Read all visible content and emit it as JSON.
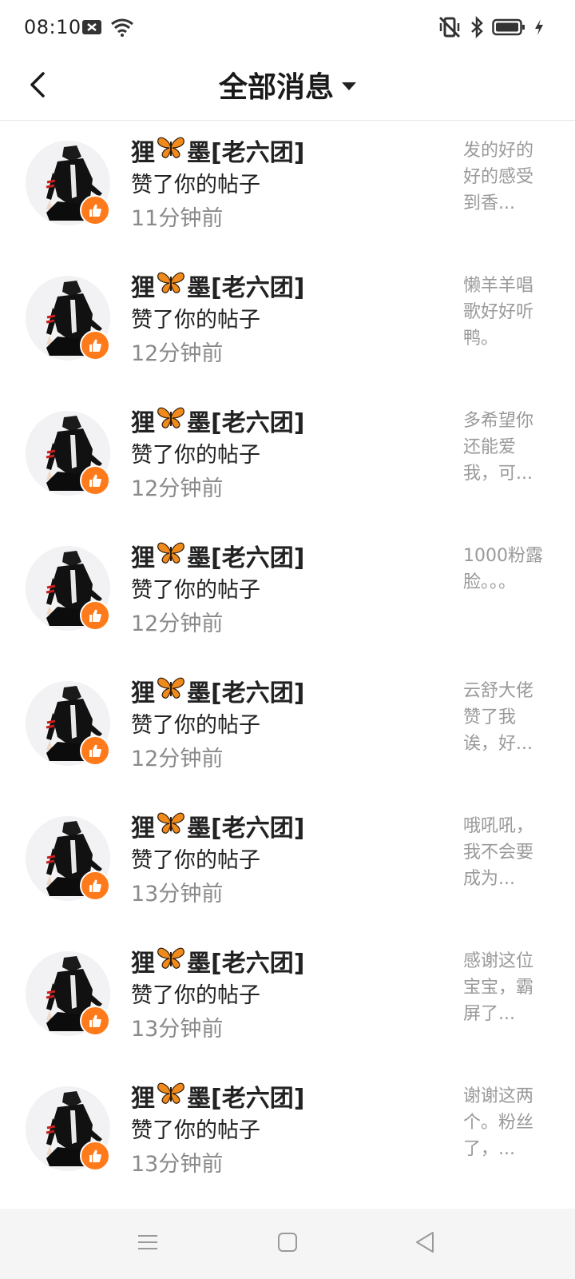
{
  "status_bar": {
    "time": "08:10",
    "icons_left": [
      "notification-x-icon",
      "wifi-icon"
    ],
    "icons_right": [
      "vibrate-icon",
      "bluetooth-icon",
      "battery-icon",
      "charging-icon"
    ]
  },
  "header": {
    "title": "全部消息",
    "back_icon": "back-arrow-icon",
    "dropdown_icon": "dropdown-arrow-icon"
  },
  "accent_color": "#ff7a1a",
  "messages": [
    {
      "name_part1": "狸",
      "name_part2": "墨[老六团]",
      "action": "赞了你的帖子",
      "time": "11分钟前",
      "preview": "发的好的好的感受到香..."
    },
    {
      "name_part1": "狸",
      "name_part2": "墨[老六团]",
      "action": "赞了你的帖子",
      "time": "12分钟前",
      "preview": "懒羊羊唱歌好好听鸭。"
    },
    {
      "name_part1": "狸",
      "name_part2": "墨[老六团]",
      "action": "赞了你的帖子",
      "time": "12分钟前",
      "preview": "多希望你还能爱我，可..."
    },
    {
      "name_part1": "狸",
      "name_part2": "墨[老六团]",
      "action": "赞了你的帖子",
      "time": "12分钟前",
      "preview": "1000粉露脸。。。"
    },
    {
      "name_part1": "狸",
      "name_part2": "墨[老六团]",
      "action": "赞了你的帖子",
      "time": "12分钟前",
      "preview": "云舒大佬赞了我诶，好..."
    },
    {
      "name_part1": "狸",
      "name_part2": "墨[老六团]",
      "action": "赞了你的帖子",
      "time": "13分钟前",
      "preview": "哦吼吼，我不会要成为..."
    },
    {
      "name_part1": "狸",
      "name_part2": "墨[老六团]",
      "action": "赞了你的帖子",
      "time": "13分钟前",
      "preview": "感谢这位宝宝，霸屏了..."
    },
    {
      "name_part1": "狸",
      "name_part2": "墨[老六团]",
      "action": "赞了你的帖子",
      "time": "13分钟前",
      "preview": "谢谢这两个。粉丝了，..."
    }
  ],
  "nav_bar": {
    "icons": [
      "menu-icon",
      "home-icon",
      "back-icon"
    ]
  }
}
